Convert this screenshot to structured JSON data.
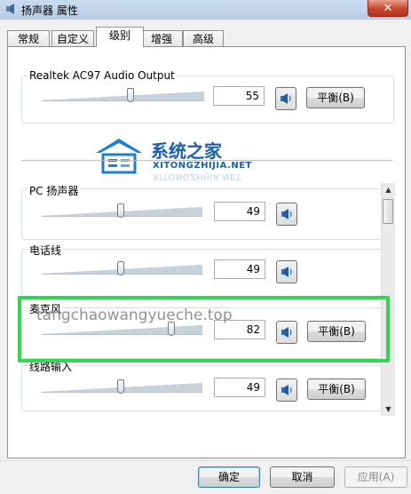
{
  "window": {
    "title": "扬声器 属性",
    "close_label": "✕",
    "icon": "speaker-icon"
  },
  "tabs": [
    "常规",
    "自定义",
    "级别",
    "增强",
    "高级"
  ],
  "active_tab": "级别",
  "master": {
    "label": "Realtek AC97 Audio Output",
    "value": "55",
    "level": 0.55,
    "balance_label": "平衡(B)"
  },
  "channels": [
    {
      "label": "PC 扬声器",
      "value": "49",
      "level": 0.49,
      "has_balance": false
    },
    {
      "label": "电话线",
      "value": "49",
      "level": 0.49,
      "has_balance": false
    },
    {
      "label": "麦克风",
      "value": "82",
      "level": 0.82,
      "has_balance": true,
      "balance_label": "平衡(B)"
    },
    {
      "label": "线路输入",
      "value": "49",
      "level": 0.49,
      "has_balance": true,
      "balance_label": "平衡(B)"
    }
  ],
  "watermark": {
    "brand": "系统之家",
    "url": "XITONGZHIJIA.NET",
    "overlay_text": "tangchaowangyueche.top"
  },
  "footer": {
    "ok_label": "确定",
    "cancel_label": "取消",
    "apply_label": "应用(A)"
  },
  "colors": {
    "highlight": "#39d353",
    "brand": "#1b5fa8"
  }
}
